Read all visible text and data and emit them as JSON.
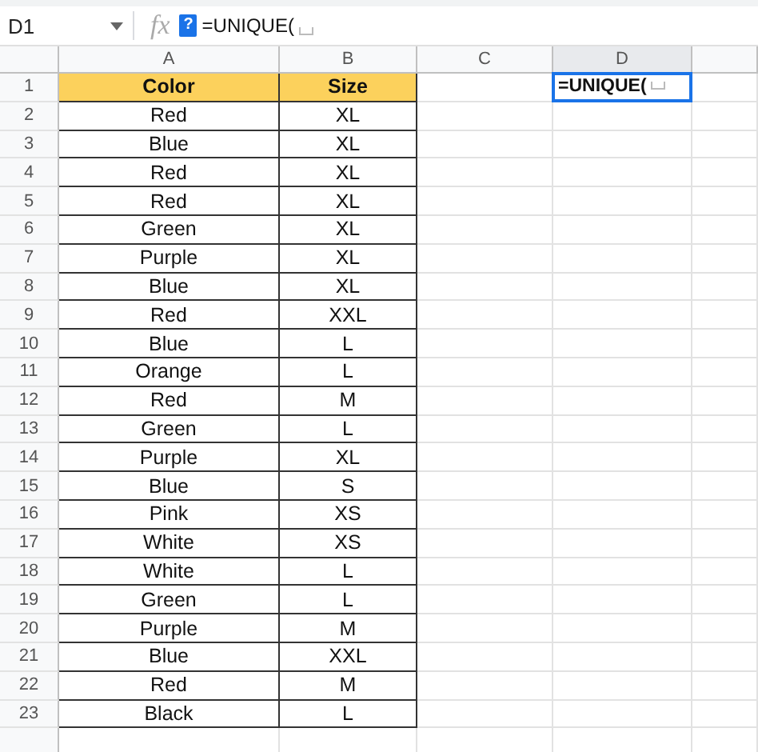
{
  "name_box": "D1",
  "fx_label": "fx",
  "help_badge": "?",
  "formula": "=UNIQUE(",
  "columns": [
    {
      "label": "A",
      "selected": false
    },
    {
      "label": "B",
      "selected": false
    },
    {
      "label": "C",
      "selected": false
    },
    {
      "label": "D",
      "selected": true
    }
  ],
  "header": {
    "row": "1",
    "cells": [
      "Color",
      "Size"
    ],
    "column_d": {
      "value": "=UNIQUE(",
      "selected": true
    }
  },
  "rows": [
    {
      "row": "2",
      "cells": [
        "Red",
        "XL"
      ]
    },
    {
      "row": "3",
      "cells": [
        "Blue",
        "XL"
      ]
    },
    {
      "row": "4",
      "cells": [
        "Red",
        "XL"
      ]
    },
    {
      "row": "5",
      "cells": [
        "Red",
        "XL"
      ]
    },
    {
      "row": "6",
      "cells": [
        "Green",
        "XL"
      ]
    },
    {
      "row": "7",
      "cells": [
        "Purple",
        "XL"
      ]
    },
    {
      "row": "8",
      "cells": [
        "Blue",
        "XL"
      ]
    },
    {
      "row": "9",
      "cells": [
        "Red",
        "XXL"
      ]
    },
    {
      "row": "10",
      "cells": [
        "Blue",
        "L"
      ]
    },
    {
      "row": "11",
      "cells": [
        "Orange",
        "L"
      ]
    },
    {
      "row": "12",
      "cells": [
        "Red",
        "M"
      ]
    },
    {
      "row": "13",
      "cells": [
        "Green",
        "L"
      ]
    },
    {
      "row": "14",
      "cells": [
        "Purple",
        "XL"
      ]
    },
    {
      "row": "15",
      "cells": [
        "Blue",
        "S"
      ]
    },
    {
      "row": "16",
      "cells": [
        "Pink",
        "XS"
      ]
    },
    {
      "row": "17",
      "cells": [
        "White",
        "XS"
      ]
    },
    {
      "row": "18",
      "cells": [
        "White",
        "L"
      ]
    },
    {
      "row": "19",
      "cells": [
        "Green",
        "L"
      ]
    },
    {
      "row": "20",
      "cells": [
        "Purple",
        "M"
      ]
    },
    {
      "row": "21",
      "cells": [
        "Blue",
        "XXL"
      ]
    },
    {
      "row": "22",
      "cells": [
        "Red",
        "M"
      ]
    },
    {
      "row": "23",
      "cells": [
        "Black",
        "L"
      ]
    }
  ]
}
